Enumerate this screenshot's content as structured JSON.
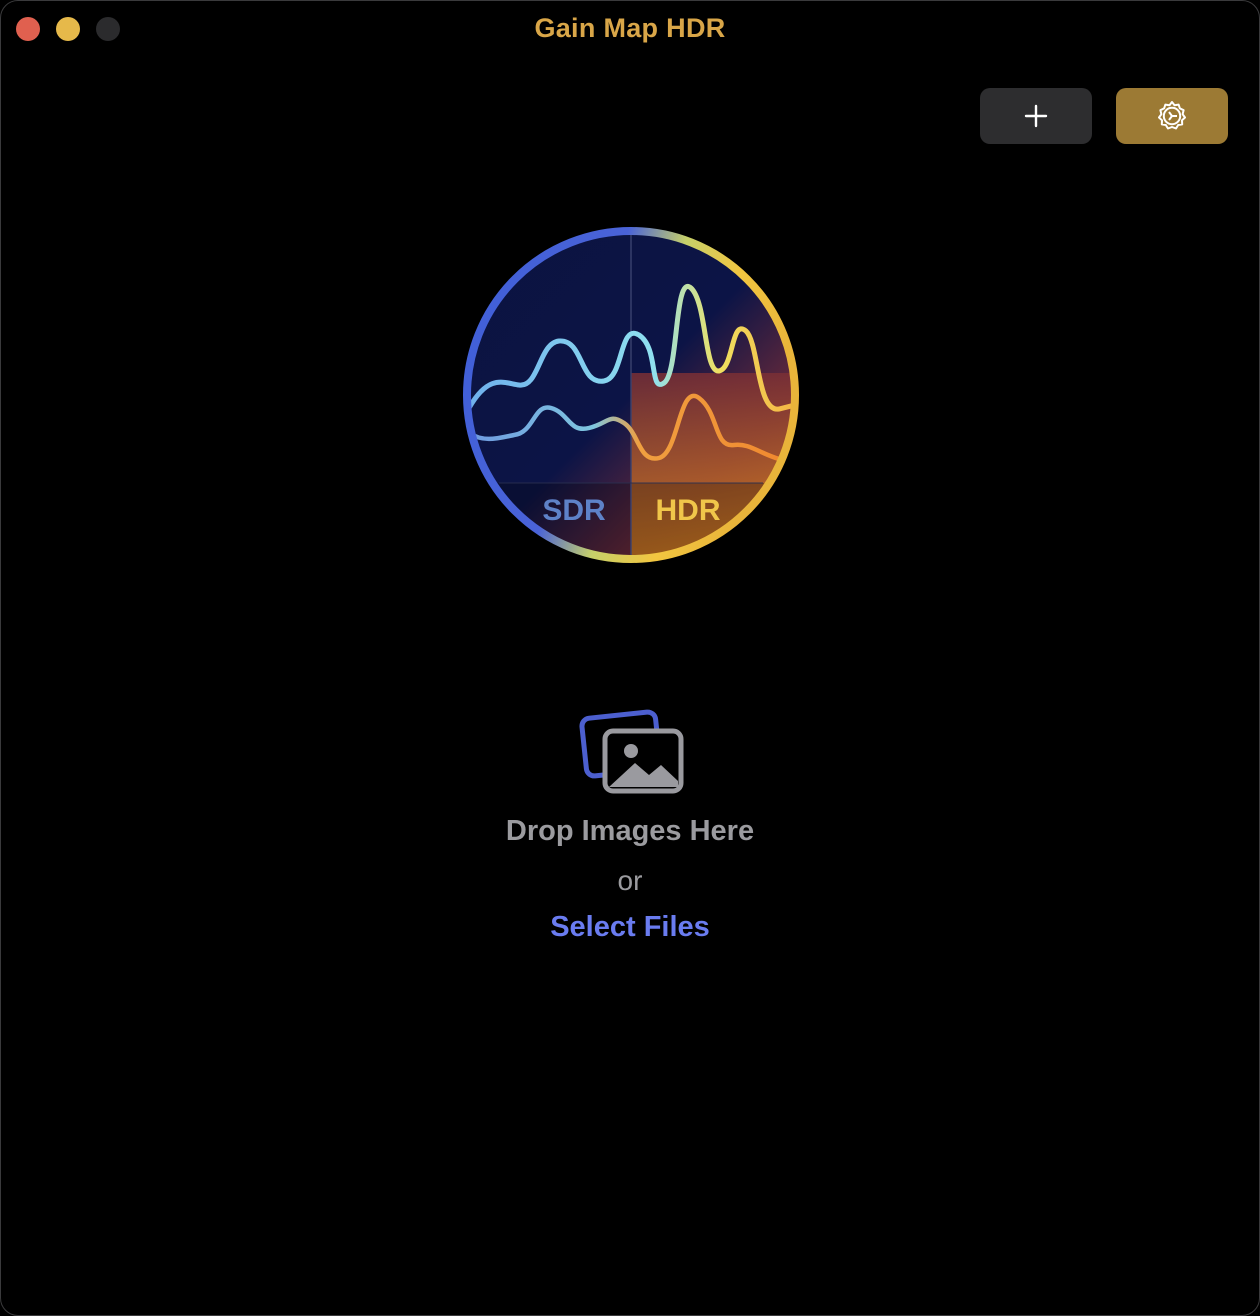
{
  "window": {
    "title": "Gain Map HDR",
    "title_color": "#d9a648",
    "traffic_lights": [
      "close",
      "minimize",
      "zoom"
    ]
  },
  "toolbar": {
    "add_button": {
      "icon": "plus-icon"
    },
    "settings_button": {
      "icon": "gear-icon",
      "color": "#9c7a34"
    }
  },
  "logo": {
    "sdr_label": "SDR",
    "hdr_label": "HDR"
  },
  "drop_zone": {
    "icon": "photos-icon",
    "title": "Drop Images Here",
    "or_text": "or",
    "select_files_label": "Select Files",
    "link_color": "#6a7cf0"
  }
}
